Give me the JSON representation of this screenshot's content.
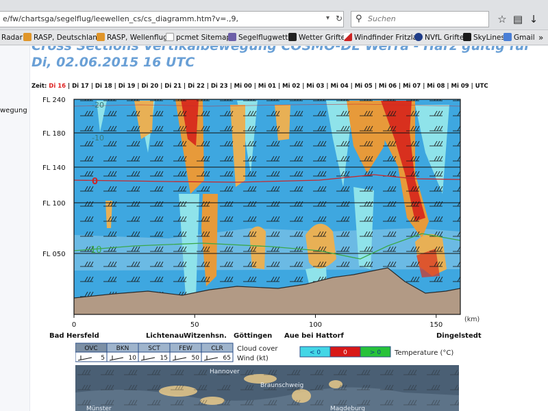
{
  "browser": {
    "url": "e/fw/chartsga/segelflug/leewellen_cs/cs_diagramm.htm?v=.,9,",
    "search_placeholder": "Suchen",
    "bookmarks": [
      "Radar",
      "RASP, Deutschland",
      "RASP, Wellenflug",
      "pcmet Sitemap",
      "Segelflugwetter",
      "Wetter Grifte",
      "Windfinder Fritzlar",
      "NVfL Grifte",
      "SkyLines",
      "Gmail"
    ]
  },
  "page": {
    "title": "Cross Sections Vertikalbewegung COSMO-DE Werra - Harz gültig für Di, 02.06.2015 16 UTC",
    "side_text": "wegung",
    "zeit_label": "Zeit:",
    "zeit_current": "Di 16",
    "zeit_items": [
      "Di 17",
      "Di 18",
      "Di 19",
      "Di 20",
      "Di 21",
      "Di 22",
      "Di 23",
      "Mi 00",
      "Mi 01",
      "Mi 02",
      "Mi 03",
      "Mi 04",
      "Mi 05",
      "Mi 06",
      "Mi 07",
      "Mi 08",
      "Mi 09",
      "UTC"
    ]
  },
  "chart_data": {
    "type": "heatmap",
    "title": "Cross Sections Vertikalbewegung COSMO-DE Werra - Harz",
    "x_unit": "(km)",
    "x_ticks": [
      0,
      50,
      100,
      150
    ],
    "xlim": [
      0,
      160
    ],
    "y_ticks": [
      "FL 240",
      "FL 180",
      "FL 140",
      "FL 100",
      "FL 050"
    ],
    "isotherms": [
      {
        "label": "0",
        "color": "#c8282c"
      },
      {
        "label": "10",
        "color": "#3aa84a"
      }
    ],
    "isotherm_top_labels": [
      "-20",
      "-10"
    ],
    "places": [
      "Bad Hersfeld",
      "Lichtenau",
      "Witzenhsn.",
      "Göttingen",
      "Aue bei Hattorf",
      "Dingelstedt"
    ],
    "cloud_cover": {
      "label": "Cloud cover",
      "categories": [
        "OVC",
        "BKN",
        "SCT",
        "FEW",
        "CLR"
      ]
    },
    "wind": {
      "label": "Wind (kt)",
      "values": [
        5,
        10,
        15,
        50,
        65
      ]
    },
    "temperature": {
      "label": "Temperature (°C)",
      "categories": [
        {
          "label": "< 0",
          "color": "#43d6e6"
        },
        {
          "label": "0",
          "color": "#d81818"
        },
        {
          "label": "> 0",
          "color": "#27c23a"
        }
      ]
    }
  },
  "map": {
    "labels": [
      "Hannover",
      "Braunschweig",
      "Münster",
      "Magdeburg"
    ]
  },
  "colors": {
    "updraft_red": "#d8301e",
    "updraft_orange": "#e79a3a",
    "neutral_blue": "#3ea7e0",
    "sink_cyan": "#8fe3ea",
    "terrain": "#b29a85",
    "title_blue": "#6aa0d6"
  }
}
